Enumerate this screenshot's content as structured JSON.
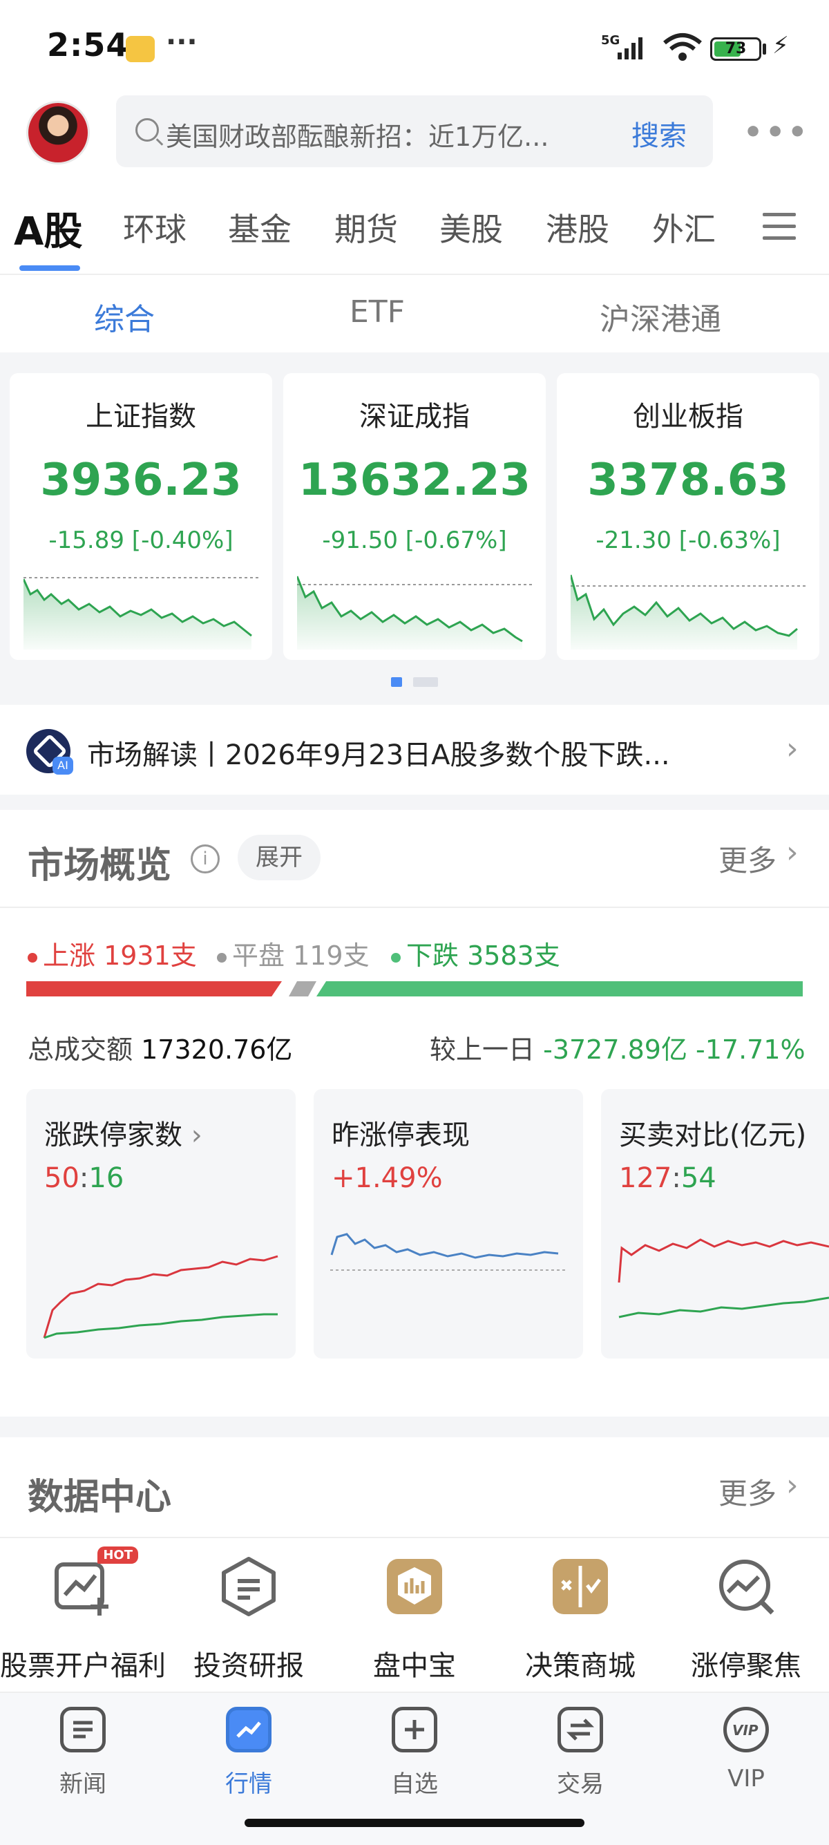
{
  "status": {
    "time": "2:54",
    "dots": "···",
    "network": "5G",
    "battery": "73"
  },
  "header": {
    "search_placeholder": "美国财政部酝酿新招：近1万亿...",
    "search_button": "搜索",
    "more": "•••"
  },
  "market_tabs": [
    "A股",
    "环球",
    "基金",
    "期货",
    "美股",
    "港股",
    "外汇"
  ],
  "sub_tabs": [
    "综合",
    "ETF",
    "沪深港通"
  ],
  "indices": [
    {
      "name": "上证指数",
      "price": "3936.23",
      "change": "-15.89 [-0.40%]"
    },
    {
      "name": "深证成指",
      "price": "13632.23",
      "change": "-91.50 [-0.67%]"
    },
    {
      "name": "创业板指",
      "price": "3378.63",
      "change": "-21.30 [-0.63%]"
    }
  ],
  "news": {
    "text": "市场解读丨2026年9月23日A股多数个股下跌...",
    "ai_tag": "AI"
  },
  "overview": {
    "title": "市场概览",
    "expand": "展开",
    "more": "更多",
    "up": "上涨 1931支",
    "flat": "平盘 119支",
    "down": "下跌 3583支",
    "turnover_label": "总成交额",
    "turnover_value": "17320.76亿",
    "compare_label": "较上一日",
    "compare_value": "-3727.89亿 -17.71%",
    "up_ratio": 0.3455,
    "colors": {
      "up": "#e0413f",
      "flat": "#999999",
      "down": "#2ea451"
    }
  },
  "mini_cards": [
    {
      "title": "涨跌停家数",
      "v1": "50",
      "sep": ":",
      "v2": "16"
    },
    {
      "title": "昨涨停表现",
      "v1": "+1.49%"
    },
    {
      "title": "买卖对比(亿元)",
      "v1": "127",
      "sep": ":",
      "v2": "54"
    }
  ],
  "data_center": {
    "title": "数据中心",
    "more": "更多",
    "items": [
      {
        "label": "股票开户福利",
        "badge": "HOT",
        "icon": "chart-plus-icon"
      },
      {
        "label": "投资研报",
        "icon": "report-icon"
      },
      {
        "label": "盘中宝",
        "icon": "treasure-icon"
      },
      {
        "label": "决策商城",
        "icon": "decision-icon"
      },
      {
        "label": "涨停聚焦",
        "icon": "focus-icon"
      }
    ]
  },
  "bottom_nav": [
    {
      "label": "新闻"
    },
    {
      "label": "行情"
    },
    {
      "label": "自选"
    },
    {
      "label": "交易"
    },
    {
      "label": "VIP"
    }
  ]
}
